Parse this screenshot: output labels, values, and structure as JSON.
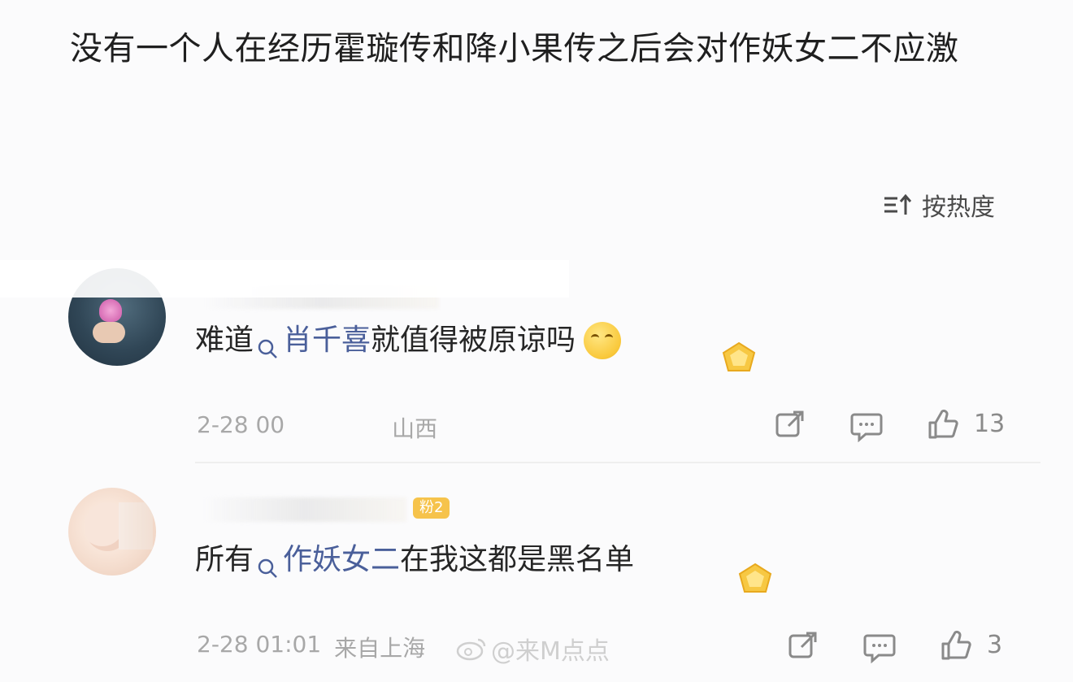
{
  "post": {
    "title": "没有一个人在经历霍璇传和降小果传之后会对作妖女二不应激"
  },
  "sort": {
    "icon": "sort-icon",
    "label": "按热度"
  },
  "comments": [
    {
      "body_prefix": "难道",
      "topic": "肖千喜",
      "body_suffix": "就值得被原谅吗",
      "emoji": "thinking-face-emoji",
      "badge_icon": "gold-medal-icon",
      "date": "2-28 00",
      "location": "山西",
      "like_count": "13"
    },
    {
      "fan_badge": "粉2",
      "body_prefix": "所有",
      "topic": "作妖女二",
      "body_suffix": "在我这都是黑名单",
      "badge_icon": "gold-medal-icon",
      "date": "2-28 01:01",
      "location": "来自上海",
      "like_count": "3"
    }
  ],
  "watermark": {
    "text": "@来M点点"
  }
}
